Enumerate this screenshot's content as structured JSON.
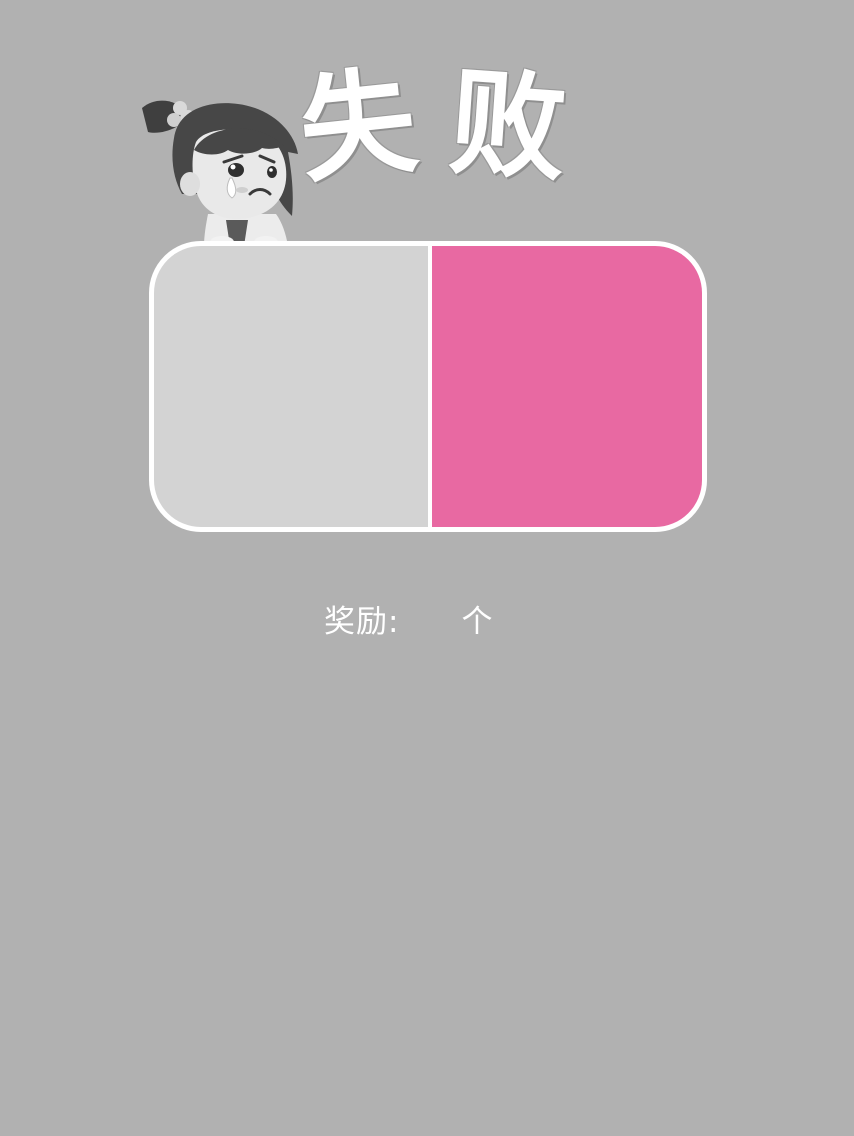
{
  "title": {
    "char_1": "失",
    "char_2": "败"
  },
  "reward": {
    "label": "奖励:",
    "value": "",
    "unit": "个"
  },
  "panel": {
    "left_color": "#d3d3d3",
    "right_color": "#e869a2"
  },
  "icons": {
    "mascot": "crying-girl-icon"
  },
  "colors": {
    "background": "#b1b1b1",
    "panel_border": "#ffffff",
    "text": "#ffffff"
  }
}
